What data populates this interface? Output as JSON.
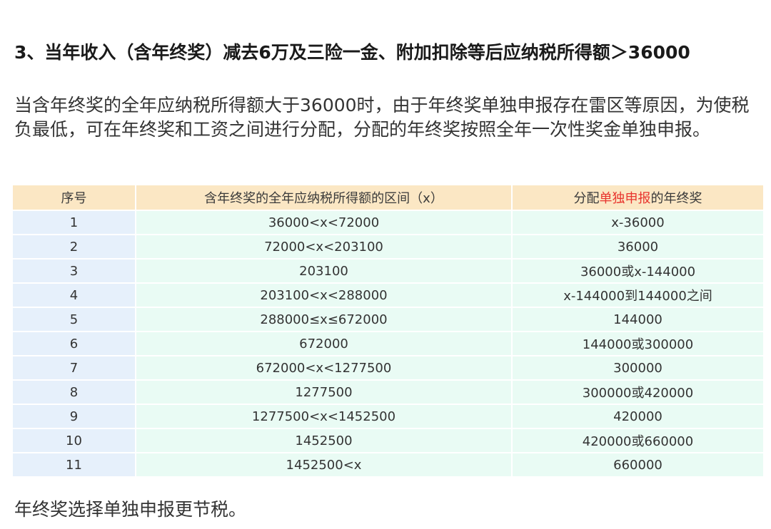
{
  "heading": "3、当年收入（含年终奖）减去6万及三险一金、附加扣除等后应纳税所得额＞36000",
  "paragraph": "当含年终奖的全年应纳税所得额大于36000时，由于年终奖单独申报存在雷区等原因，为使税负最低，可在年终奖和工资之间进行分配，分配的年终奖按照全年一次性奖金单独申报。",
  "table": {
    "header": {
      "col1": "序号",
      "col2": "含年终奖的全年应纳税所得额的区间（x）",
      "col3_prefix": "分配",
      "col3_highlight": "单独申报",
      "col3_suffix": "的年终奖"
    },
    "rows": [
      {
        "no": "1",
        "range": "36000<x<72000",
        "bonus": "x-36000"
      },
      {
        "no": "2",
        "range": "72000<x<203100",
        "bonus": "36000"
      },
      {
        "no": "3",
        "range": "203100",
        "bonus": "36000或x-144000"
      },
      {
        "no": "4",
        "range": "203100<x<288000",
        "bonus": "x-144000到144000之间"
      },
      {
        "no": "5",
        "range": "288000≤x≤672000",
        "bonus": "144000"
      },
      {
        "no": "6",
        "range": "672000",
        "bonus": "144000或300000"
      },
      {
        "no": "7",
        "range": "672000<x<1277500",
        "bonus": "300000"
      },
      {
        "no": "8",
        "range": "1277500",
        "bonus": "300000或420000"
      },
      {
        "no": "9",
        "range": "1277500<x<1452500",
        "bonus": "420000"
      },
      {
        "no": "10",
        "range": "1452500",
        "bonus": "420000或660000"
      },
      {
        "no": "11",
        "range": "1452500<x",
        "bonus": "660000"
      }
    ]
  },
  "footer": "年终奖选择单独申报更节税。",
  "colors": {
    "header_bg": "#fbe7c4",
    "index_bg": "#e6f0fb",
    "value_bg": "#e9fbf4",
    "highlight": "#e8342d"
  }
}
